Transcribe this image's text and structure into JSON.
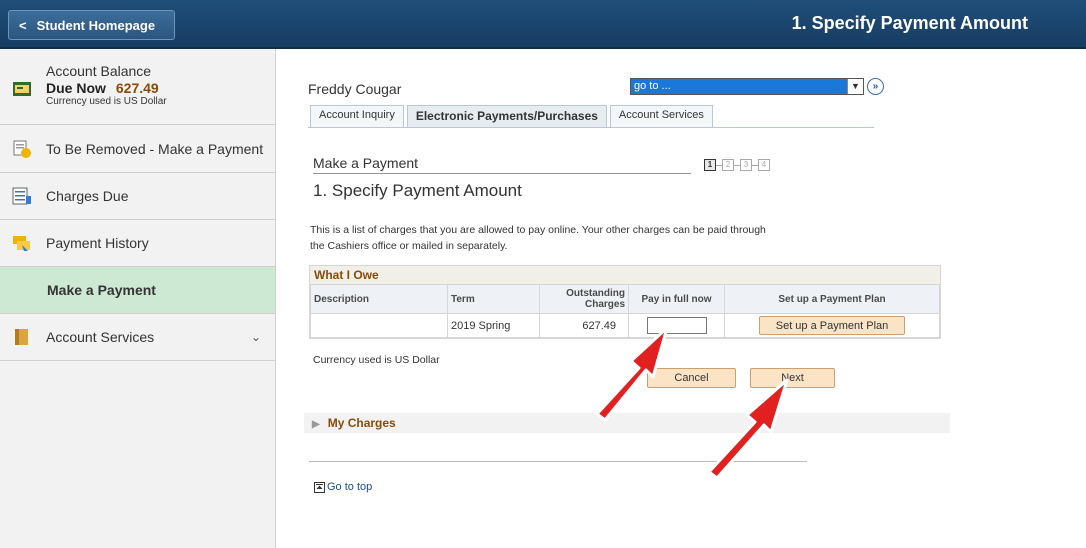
{
  "header": {
    "home_button": "Student Homepage",
    "title": "1. Specify Payment Amount"
  },
  "sidebar": {
    "account": {
      "label": "Account Balance",
      "due_label": "Due Now",
      "due_amount": "627.49",
      "currency_note": "Currency used is US Dollar"
    },
    "items": [
      {
        "label": "To Be Removed - Make a Payment"
      },
      {
        "label": "Charges Due"
      },
      {
        "label": "Payment History"
      },
      {
        "label": "Make a Payment"
      },
      {
        "label": "Account Services"
      }
    ]
  },
  "main": {
    "student_name": "Freddy Cougar",
    "goto_value": "go to ...",
    "tabs": [
      {
        "label": "Account Inquiry"
      },
      {
        "label": "Electronic Payments/Purchases"
      },
      {
        "label": "Account Services"
      }
    ],
    "section_title": "Make a Payment",
    "steps": [
      "1",
      "2",
      "3",
      "4"
    ],
    "sub_title": "1. Specify Payment Amount",
    "intro": "This is a list of charges that you are allowed to pay online. Your other charges can be paid through the Cashiers office or mailed in separately.",
    "owe": {
      "heading": "What I Owe",
      "columns": [
        "Description",
        "Term",
        "Outstanding Charges",
        "Pay in full now",
        "Set up a Payment Plan"
      ],
      "rows": [
        {
          "description": "",
          "term": "2019 Spring",
          "outstanding": "627.49",
          "pay_value": "",
          "plan_button": "Set up a Payment Plan"
        }
      ]
    },
    "currency_note": "Currency used is US Dollar",
    "cancel_label": "Cancel",
    "next_label": "Next",
    "my_charges": "My Charges",
    "go_to_top": "Go to top"
  },
  "colors": {
    "header_bg": "#1f4e79",
    "active_item_bg": "#cde9d4",
    "accent_brown": "#8a4b07",
    "button_bg": "#fbe4c6",
    "annotation_arrow": "#e32020"
  }
}
